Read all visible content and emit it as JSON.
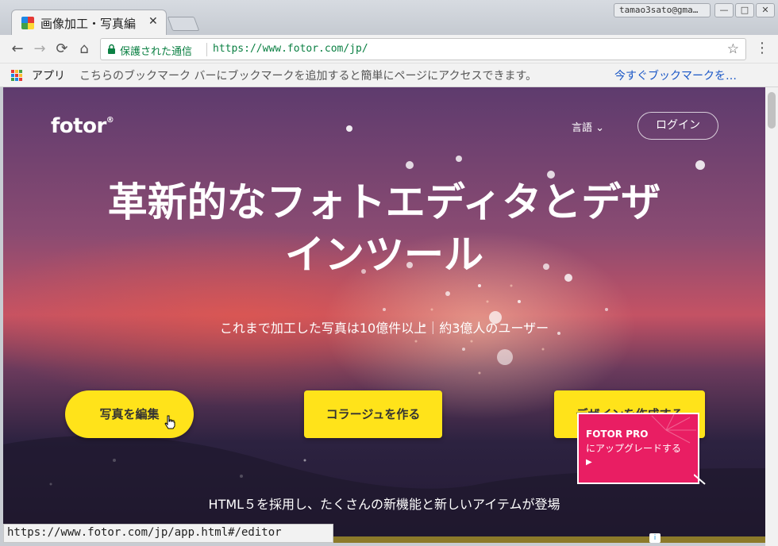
{
  "browser": {
    "tab": {
      "title": "画像加工・写真編",
      "close": "✕"
    },
    "user": "tamao3sato@gma…",
    "window_controls": {
      "min": "—",
      "max": "□",
      "close": "✕"
    },
    "nav": {
      "back": "←",
      "forward": "→",
      "reload": "⟳",
      "home": "⌂"
    },
    "address": {
      "secure_label": "保護された通信",
      "url": "https://www.fotor.com/jp/"
    },
    "star": "☆",
    "menu": "⋮",
    "bookmarks": {
      "apps_label": "アプリ",
      "message": "こちらのブックマーク バーにブックマークを追加すると簡単にページにアクセスできます。",
      "link": "今すぐブックマークを…"
    },
    "status_url": "https://www.fotor.com/jp/app.html#/editor"
  },
  "page": {
    "logo": "fotor",
    "logo_mark": "®",
    "language": "言語 ⌄",
    "login": "ログイン",
    "hero_title": "革新的なフォトエディタとデザインツール",
    "hero_subtitle": "これまで加工した写真は10億件以上｜約3億人のユーザー",
    "cta_edit": "写真を編集",
    "cta_collage": "コラージュを作る",
    "cta_design": "デザインを作成する",
    "pro_popup": {
      "title": "FOTOR PRO",
      "subtitle": "にアップグレードする",
      "arrow": "▶"
    },
    "bottom_text": "HTML５を採用し、たくさんの新機能と新しいアイテムが登場",
    "ad_icon": "i"
  },
  "colors": {
    "cta": "#ffe31a",
    "popup": "#e91e63",
    "secure": "#0b8043",
    "link": "#1a57c6"
  }
}
